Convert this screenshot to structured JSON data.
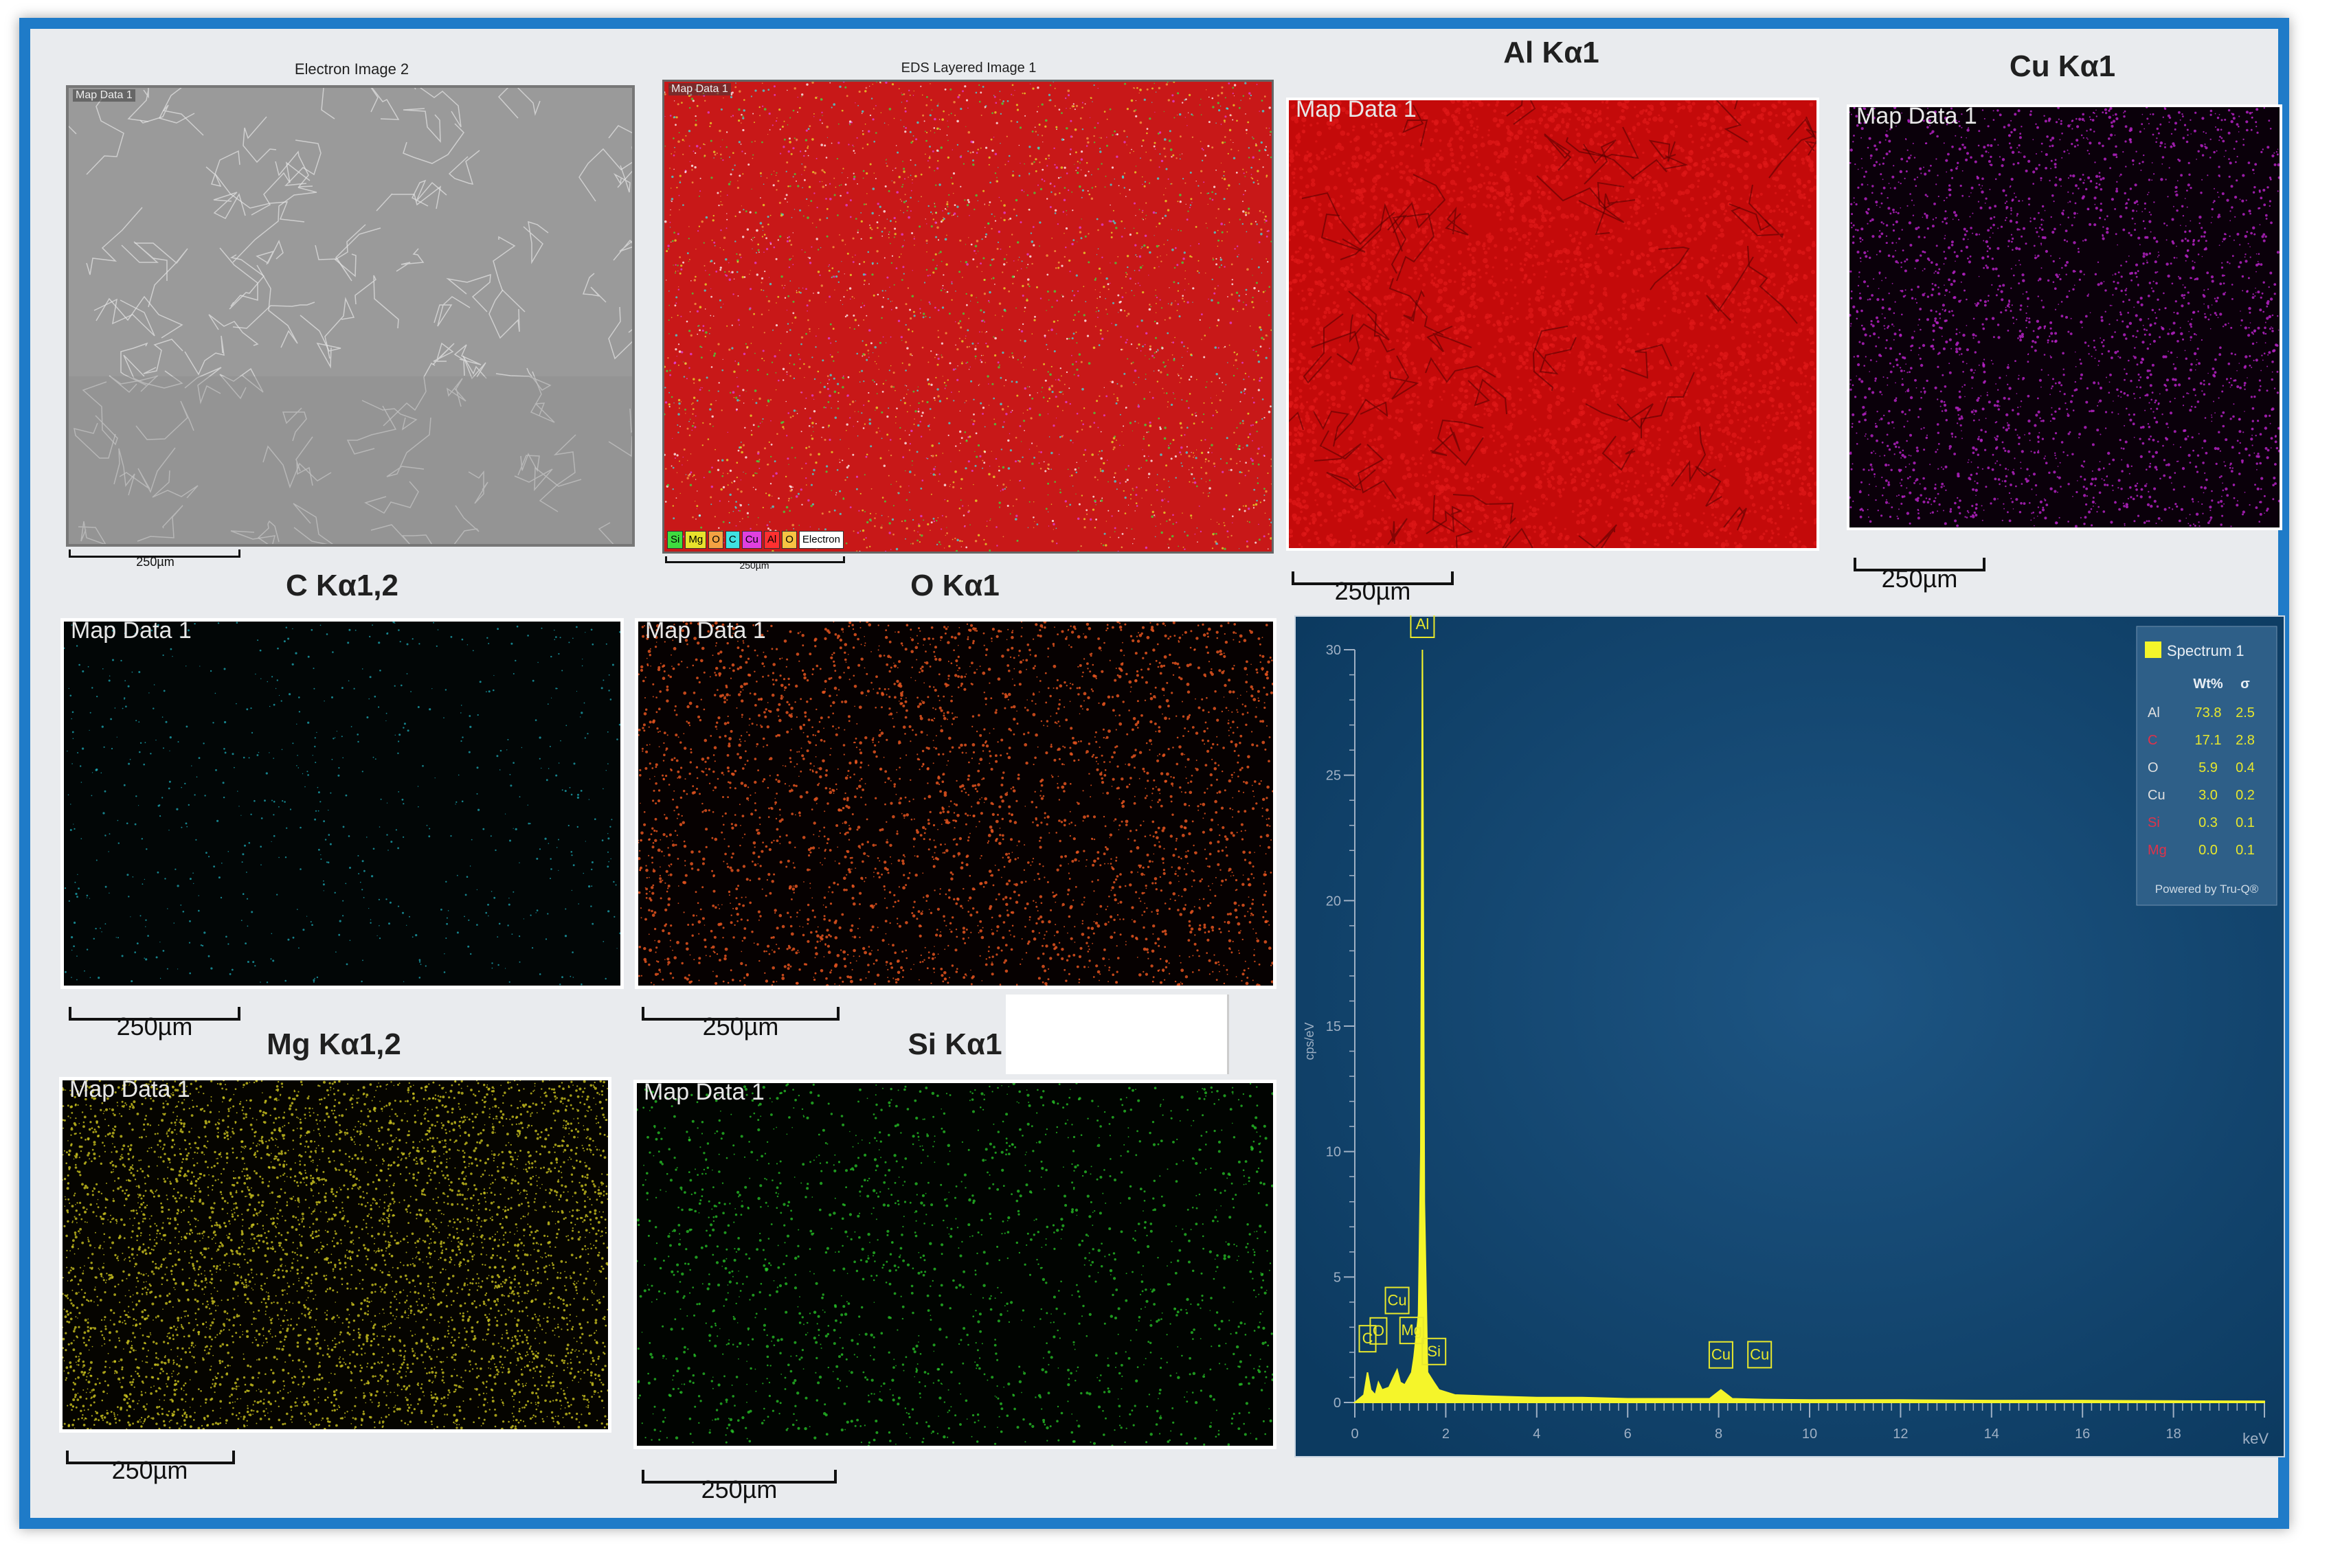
{
  "panels": {
    "electron": {
      "title": "Electron Image 2",
      "map_label": "Map Data 1",
      "scale": "250µm"
    },
    "layered": {
      "title": "EDS Layered Image 1",
      "map_label": "Map Data 1",
      "scale": "250µm",
      "legend": [
        {
          "label": "Si",
          "color": "#3fdc3f"
        },
        {
          "label": "Mg",
          "color": "#e8e22c"
        },
        {
          "label": "O",
          "color": "#f3a243"
        },
        {
          "label": "C",
          "color": "#3fe2e2"
        },
        {
          "label": "Cu",
          "color": "#e040e0"
        },
        {
          "label": "Al",
          "color": "#ff3030"
        },
        {
          "label": "O",
          "color": "#f7c343"
        },
        {
          "label": "Electron",
          "color": "#ffffff"
        }
      ]
    },
    "al": {
      "title": "Al Kα1",
      "map_label": "Map Data 1",
      "scale": "250µm",
      "color": "#d10d0d"
    },
    "cu": {
      "title": "Cu Kα1",
      "map_label": "Map Data 1",
      "scale": "250µm",
      "color": "#b321c2"
    },
    "c": {
      "title": "C Kα1,2",
      "map_label": "Map Data 1",
      "scale": "250µm",
      "color": "#1fb8c4"
    },
    "o": {
      "title": "O Kα1",
      "map_label": "Map Data 1",
      "scale": "250µm",
      "color": "#e4541e"
    },
    "mg": {
      "title": "Mg Kα1,2",
      "map_label": "Map Data 1",
      "scale": "250µm",
      "color": "#c9c21e"
    },
    "si": {
      "title": "Si Kα1",
      "map_label": "Map Data 1",
      "scale": "250µm",
      "color": "#28c828"
    }
  },
  "chart_data": {
    "type": "line",
    "ylabel": "cps/eV",
    "xunit": "keV",
    "xlim": [
      0,
      20
    ],
    "ylim": [
      0,
      30
    ],
    "xticks": [
      0,
      2,
      4,
      6,
      8,
      10,
      12,
      14,
      16,
      18
    ],
    "yticks": [
      0,
      5,
      10,
      15,
      20,
      25,
      30
    ],
    "series": [
      {
        "name": "Spectrum 1",
        "x": [
          0,
          0.2,
          0.28,
          0.35,
          0.45,
          0.52,
          0.6,
          0.75,
          0.93,
          1.0,
          1.1,
          1.25,
          1.3,
          1.4,
          1.45,
          1.487,
          1.53,
          1.6,
          1.74,
          1.85,
          2.2,
          3,
          4,
          5,
          6,
          7,
          7.8,
          8.05,
          8.3,
          9,
          10,
          12,
          14,
          16,
          18,
          20
        ],
        "y": [
          0,
          0.3,
          1.2,
          0.5,
          0.3,
          0.8,
          0.5,
          0.6,
          1.3,
          0.8,
          0.7,
          1.2,
          1.8,
          3.5,
          10,
          30,
          8,
          1.2,
          0.8,
          0.5,
          0.3,
          0.25,
          0.2,
          0.2,
          0.15,
          0.15,
          0.15,
          0.5,
          0.15,
          0.12,
          0.1,
          0.1,
          0.08,
          0.08,
          0.06,
          0.05
        ]
      }
    ],
    "peak_labels": [
      {
        "label": "C",
        "x": 0.28,
        "y": 1.2,
        "color": "#e8e82c"
      },
      {
        "label": "O",
        "x": 0.52,
        "y": 0.8,
        "color": "#e8e82c"
      },
      {
        "label": "Cu",
        "x": 0.93,
        "y": 1.3,
        "color": "#e8e82c"
      },
      {
        "label": "Mg",
        "x": 1.25,
        "y": 1.2,
        "color": "#e8e82c"
      },
      {
        "label": "Al",
        "x": 1.487,
        "y": 30,
        "color": "#e8e82c"
      },
      {
        "label": "Si",
        "x": 1.74,
        "y": 0.8,
        "color": "#e8e82c"
      },
      {
        "label": "Cu",
        "x": 8.05,
        "y": 0.5,
        "color": "#e8e82c"
      },
      {
        "label": "Cu",
        "x": 8.9,
        "y": 0.4,
        "color": "#e8e82c"
      }
    ],
    "legend": {
      "series_name": "Spectrum 1",
      "headers": [
        "Wt%",
        "σ"
      ],
      "rows": [
        {
          "element": "Al",
          "wt": "73.8",
          "sigma": "2.5",
          "label_color": "#e0e0e0"
        },
        {
          "element": "C",
          "wt": "17.1",
          "sigma": "2.8",
          "label_color": "#e0324a"
        },
        {
          "element": "O",
          "wt": "5.9",
          "sigma": "0.4",
          "label_color": "#e0e0e0"
        },
        {
          "element": "Cu",
          "wt": "3.0",
          "sigma": "0.2",
          "label_color": "#e0e0e0"
        },
        {
          "element": "Si",
          "wt": "0.3",
          "sigma": "0.1",
          "label_color": "#e0324a"
        },
        {
          "element": "Mg",
          "wt": "0.0",
          "sigma": "0.1",
          "label_color": "#e0324a"
        }
      ],
      "footer": "Powered by Tru-Q®",
      "value_color": "#e8e82c"
    }
  },
  "colors": {
    "frame": "#1f7bc8",
    "chart_bg": "#103e63",
    "trace": "#f5f52a"
  }
}
